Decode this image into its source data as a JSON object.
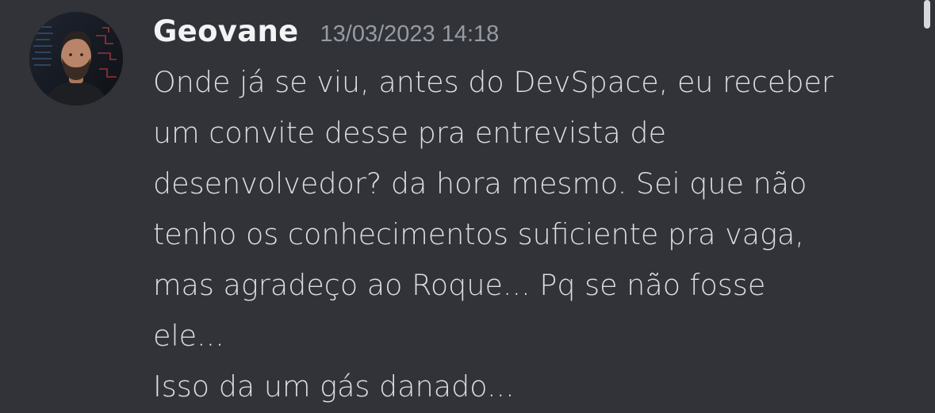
{
  "message": {
    "author": "Geovane",
    "timestamp": "13/03/2023 14:18",
    "lines": [
      "Onde já se viu, antes do DevSpace, eu receber",
      "um convite desse pra entrevista de",
      "desenvolvedor? da hora mesmo. Sei que não",
      "tenho os conhecimentos suficiente pra vaga,",
      "mas agradeço ao Roque... Pq se não fosse",
      "ele...",
      "Isso da um gás danado..."
    ]
  },
  "colors": {
    "background": "#313338",
    "username": "#f2f3f5",
    "timestamp": "#949ba4",
    "text": "#dbdee1"
  }
}
